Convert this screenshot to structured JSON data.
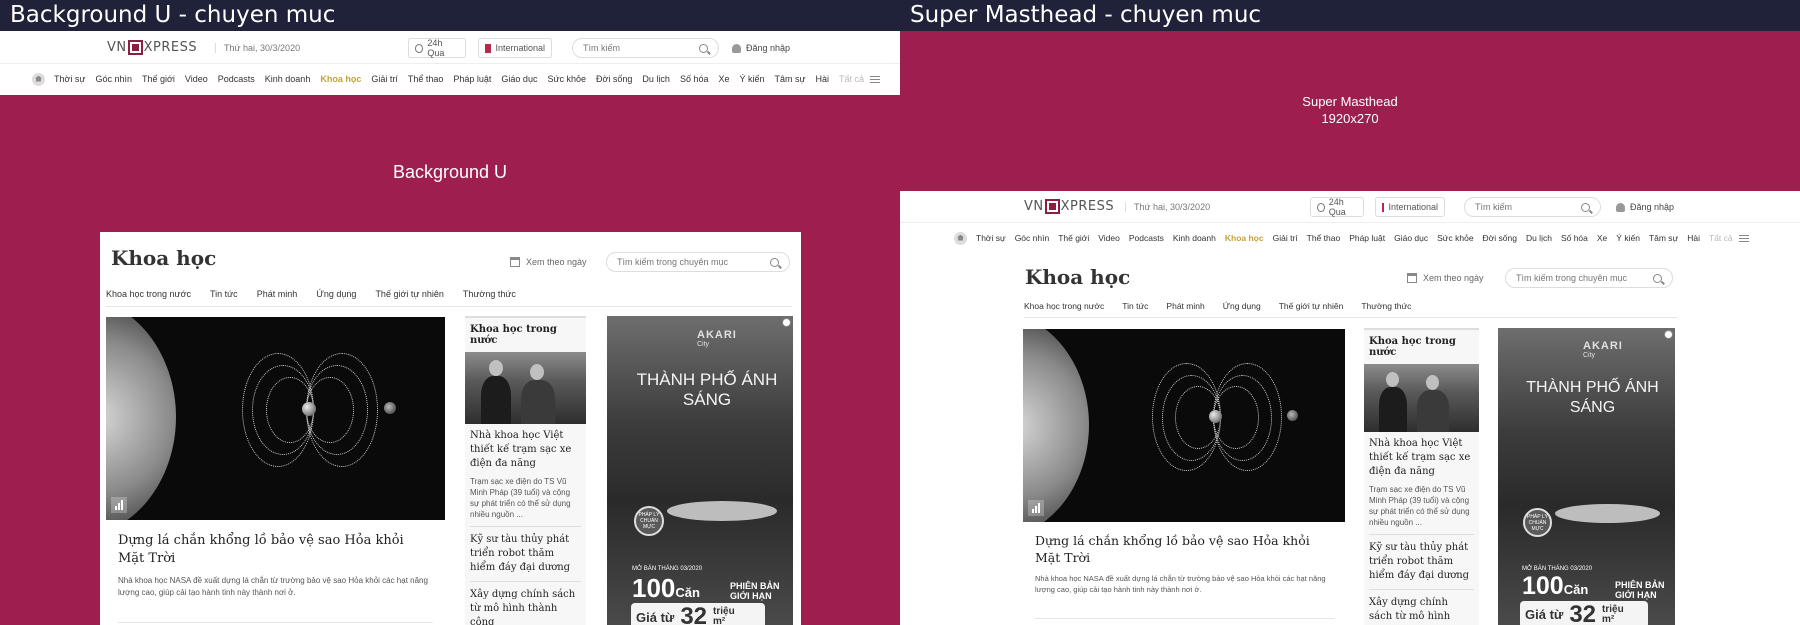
{
  "panels": {
    "left_title": "Background U - chuyen muc",
    "right_title": "Super Masthead - chuyen muc",
    "bg_label": "Background U",
    "masthead_label": "Super Masthead",
    "masthead_size": "1920x270"
  },
  "header": {
    "logo_left": "VN",
    "logo_right": "XPRESS",
    "date": "Thứ hai, 30/3/2020",
    "news24": "24h Qua",
    "international": "International",
    "search_placeholder": "Tìm kiếm",
    "login": "Đăng nhập",
    "nav": [
      "Thời sự",
      "Góc nhìn",
      "Thế giới",
      "Video",
      "Podcasts",
      "Kinh doanh",
      "Khoa học",
      "Giải trí",
      "Thể thao",
      "Pháp luật",
      "Giáo dục",
      "Sức khỏe",
      "Đời sống",
      "Du lịch",
      "Số hóa",
      "Xe",
      "Ý kiến",
      "Tâm sự",
      "Hài"
    ],
    "nav_active": "Khoa học",
    "nav_all": "Tất cả"
  },
  "category": {
    "title": "Khoa học",
    "by_date": "Xem theo ngày",
    "search_placeholder": "Tìm kiếm trong chuyên mục",
    "subnav": [
      "Khoa học trong nước",
      "Tin tức",
      "Phát minh",
      "Ứng dụng",
      "Thế giới tự nhiên",
      "Thường thức"
    ]
  },
  "hero": {
    "headline": "Dựng lá chắn khổng lồ bảo vệ sao Hỏa khỏi Mặt Trời",
    "lead": "Nhà khoa học NASA đề xuất dựng lá chắn từ trường bảo vệ sao Hỏa khỏi các hạt năng lượng cao, giúp cải tạo hành tinh này thành nơi ở."
  },
  "sidebar": {
    "heading": "Khoa học trong nước",
    "items": [
      {
        "title": "Nhà khoa học Việt thiết kế trạm sạc xe điện đa năng",
        "lead": "Trạm sạc xe điện do TS Vũ Minh Pháp (39 tuổi) và cộng sự phát triển có thể sử dụng nhiều nguồn ..."
      },
      {
        "title": "Kỹ sư tàu thủy phát triển robot thăm hiểm đáy đại dương"
      },
      {
        "title": "Xây dựng chính sách từ mô hình thành công"
      }
    ]
  },
  "ad": {
    "brand": "AKARI",
    "brand_sub": "City",
    "slogan": "THÀNH PHỐ ÁNH SÁNG",
    "seal": "PHÁP LÝ CHUẨN MỰC",
    "month": "MỞ BÁN THÁNG 03/2020",
    "big": "100",
    "big_unit": "Căn",
    "limited": "PHIÊN BẢN GIỚI HẠN",
    "price_prefix": "Giá từ",
    "price": "32",
    "price_unit": "triệu",
    "price_unit2": "m²"
  }
}
